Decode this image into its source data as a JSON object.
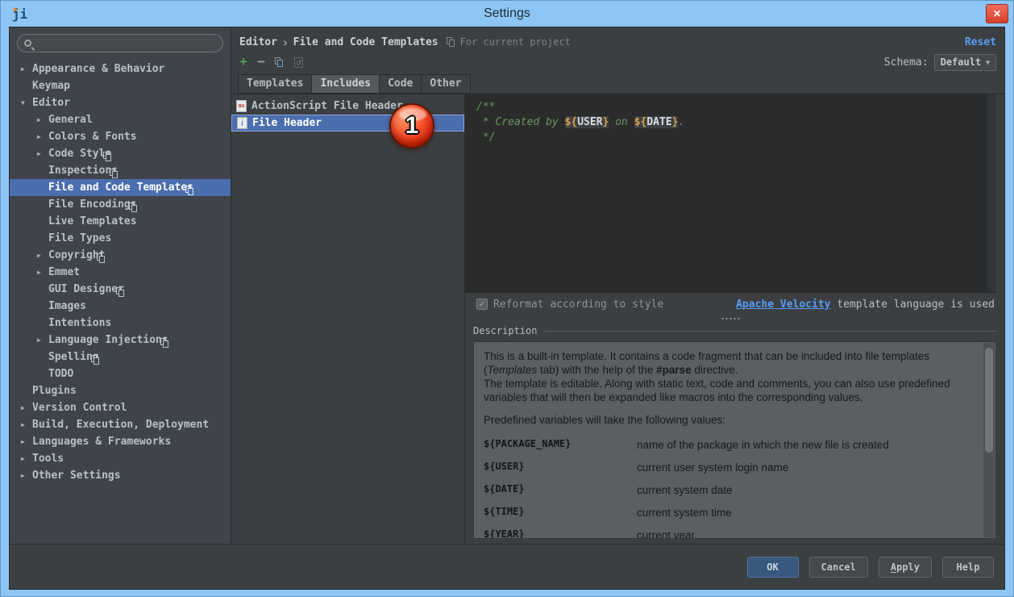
{
  "window": {
    "title": "Settings"
  },
  "sidebar": {
    "search": {
      "placeholder": ""
    },
    "tree": [
      {
        "label": "Appearance & Behavior",
        "level": 1,
        "arrow": "right"
      },
      {
        "label": "Keymap",
        "level": 1
      },
      {
        "label": "Editor",
        "level": 1,
        "arrow": "down"
      },
      {
        "label": "General",
        "level": 2,
        "arrow": "right"
      },
      {
        "label": "Colors & Fonts",
        "level": 2,
        "arrow": "right"
      },
      {
        "label": "Code Style",
        "level": 2,
        "arrow": "right",
        "badge": true
      },
      {
        "label": "Inspections",
        "level": 2,
        "badge": true
      },
      {
        "label": "File and Code Templates",
        "level": 2,
        "badge": true,
        "selected": true
      },
      {
        "label": "File Encodings",
        "level": 2,
        "badge": true
      },
      {
        "label": "Live Templates",
        "level": 2
      },
      {
        "label": "File Types",
        "level": 2
      },
      {
        "label": "Copyright",
        "level": 2,
        "arrow": "right",
        "badge": true
      },
      {
        "label": "Emmet",
        "level": 2,
        "arrow": "right"
      },
      {
        "label": "GUI Designer",
        "level": 2,
        "badge": true
      },
      {
        "label": "Images",
        "level": 2
      },
      {
        "label": "Intentions",
        "level": 2
      },
      {
        "label": "Language Injections",
        "level": 2,
        "arrow": "right",
        "badge": true
      },
      {
        "label": "Spelling",
        "level": 2,
        "badge": true
      },
      {
        "label": "TODO",
        "level": 2
      },
      {
        "label": "Plugins",
        "level": 1
      },
      {
        "label": "Version Control",
        "level": 1,
        "arrow": "right"
      },
      {
        "label": "Build, Execution, Deployment",
        "level": 1,
        "arrow": "right"
      },
      {
        "label": "Languages & Frameworks",
        "level": 1,
        "arrow": "right"
      },
      {
        "label": "Tools",
        "level": 1,
        "arrow": "right"
      },
      {
        "label": "Other Settings",
        "level": 1,
        "arrow": "right"
      }
    ]
  },
  "header": {
    "breadcrumb_parent": "Editor",
    "separator": "›",
    "breadcrumb_current": "File and Code Templates",
    "scope_note": "For current project",
    "reset": "Reset"
  },
  "toolbar": {
    "schema_label": "Schema:",
    "schema_value": "Default"
  },
  "tabs": [
    {
      "label": "Templates"
    },
    {
      "label": "Includes",
      "selected": true
    },
    {
      "label": "Code"
    },
    {
      "label": "Other"
    }
  ],
  "template_list": [
    {
      "label": "ActionScript File Header",
      "icon": "as"
    },
    {
      "label": "File Header",
      "icon": "j",
      "selected": true
    }
  ],
  "annotation": {
    "badge": "1"
  },
  "editor": {
    "line1": "/**",
    "line2": {
      "prefix": " * Created by ",
      "var1": "${USER}",
      "mid": " on ",
      "var2": "${DATE}",
      "suffix": "."
    },
    "line3": " */"
  },
  "reformat": {
    "label": "Reformat according to style",
    "checked": true
  },
  "velocity": {
    "link_text": "Apache Velocity",
    "suffix": " template language is used"
  },
  "description": {
    "title": "Description",
    "para1": {
      "pre": "This is a built-in template. It contains a code fragment that can be included into file templates (",
      "italic": "Templates",
      "mid": " tab) with the help of the ",
      "bold": "#parse",
      "post": " directive."
    },
    "para2": "The template is editable. Along with static text, code and comments, you can also use predefined variables that will then be expanded like macros into the corresponding values.",
    "para3": "Predefined variables will take the following values:",
    "variables": [
      {
        "name": "${PACKAGE_NAME}",
        "desc": "name of the package in which the new file is created"
      },
      {
        "name": "${USER}",
        "desc": "current user system login name"
      },
      {
        "name": "${DATE}",
        "desc": "current system date"
      },
      {
        "name": "${TIME}",
        "desc": "current system time"
      },
      {
        "name": "${YEAR}",
        "desc": "current year"
      }
    ]
  },
  "footer": {
    "buttons": [
      {
        "label": "OK",
        "primary": true
      },
      {
        "label": "Cancel"
      },
      {
        "label": "Apply",
        "mnemonic": "A"
      },
      {
        "label": "Help"
      }
    ]
  },
  "colors": {
    "titlebar_blue": "#8dc6f5",
    "selection_blue": "#4b6eaf",
    "link_blue": "#589df6",
    "editor_bg": "#2b2b2b",
    "comment_green": "#6a9561",
    "badge_red": "#e2391b"
  }
}
